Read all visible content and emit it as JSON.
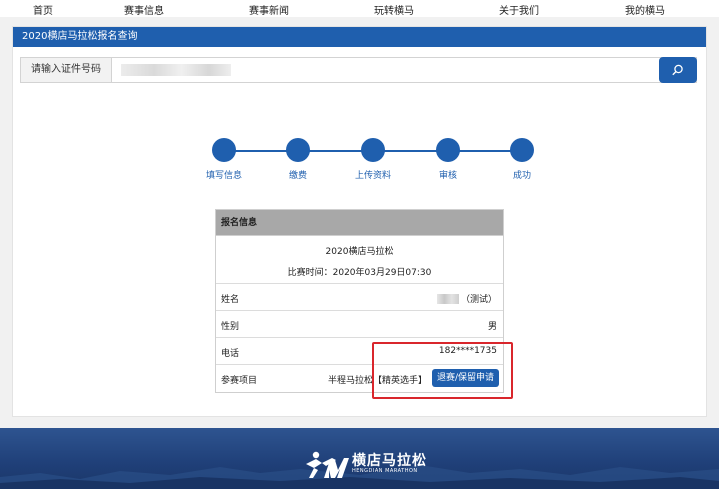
{
  "nav": {
    "items": [
      {
        "label": "首页"
      },
      {
        "label": "赛事信息"
      },
      {
        "label": "赛事新闻"
      },
      {
        "label": "玩转横马"
      },
      {
        "label": "关于我们"
      },
      {
        "label": "我的横马"
      }
    ]
  },
  "panel": {
    "title": "2020横店马拉松报名查询"
  },
  "search": {
    "label": "请输入证件号码",
    "value": "",
    "button_icon": "search-icon"
  },
  "steps": [
    {
      "label": "填写信息"
    },
    {
      "label": "缴费"
    },
    {
      "label": "上传资料"
    },
    {
      "label": "审核"
    },
    {
      "label": "成功"
    }
  ],
  "info": {
    "header": "报名信息",
    "race_name": "2020横店马拉松",
    "race_time": "比赛时间：2020年03月29日07:30",
    "rows": {
      "name": {
        "key": "姓名",
        "value": "（测试）"
      },
      "gender": {
        "key": "性别",
        "value": "男"
      },
      "phone": {
        "key": "电话",
        "value": "182****1735"
      },
      "event": {
        "key": "参赛项目",
        "value": "半程马拉松【精英选手】",
        "button": "退赛/保留申请"
      }
    }
  },
  "footer": {
    "logo_main": "横店马拉松",
    "logo_sub": "HENGDIAN MARATHON",
    "logo_icon": "runner-logo-icon"
  },
  "colors": {
    "brand_blue": "#1f5fae",
    "annotation_red": "#d9262c",
    "footer_blue": "#1f3f78"
  }
}
